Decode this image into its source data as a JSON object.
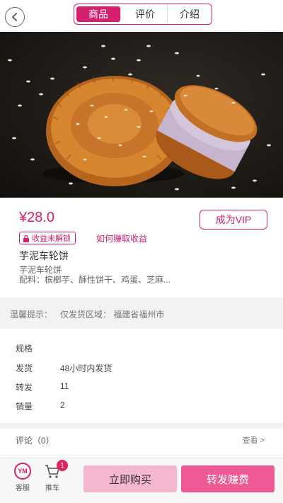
{
  "header": {
    "tabs": [
      {
        "label": "商品"
      },
      {
        "label": "评价"
      },
      {
        "label": "介绍"
      }
    ]
  },
  "product": {
    "price": "¥28.0",
    "vip_label": "成为VIP",
    "locked_badge": "收益未解锁",
    "earn_link": "如何赚取收益",
    "title": "芋泥车轮饼",
    "subtitle": "芋泥车轮饼",
    "ingredients": "配料：槟榔芋、酥性饼干、鸡蛋、芝麻..."
  },
  "tip": {
    "label": "温馨提示：",
    "value": "仅发货区域：  福建省福州市"
  },
  "info": {
    "spec_label": "规格",
    "ship_label": "发货",
    "ship_value": "48小时内发货",
    "forward_label": "转发",
    "forward_value": "11",
    "sales_label": "销量",
    "sales_value": "2"
  },
  "comments": {
    "title": "评论（0）",
    "more": "查看 >"
  },
  "bottom": {
    "service_icon_text": "YM",
    "service_label": "客服",
    "cart_label": "推车",
    "cart_count": "1",
    "buy_label": "立即购买",
    "share_label": "转发赚费"
  },
  "colors": {
    "accent": "#d4206e",
    "buy_button": "#f5b6cf",
    "share_button": "#ee5a93"
  }
}
